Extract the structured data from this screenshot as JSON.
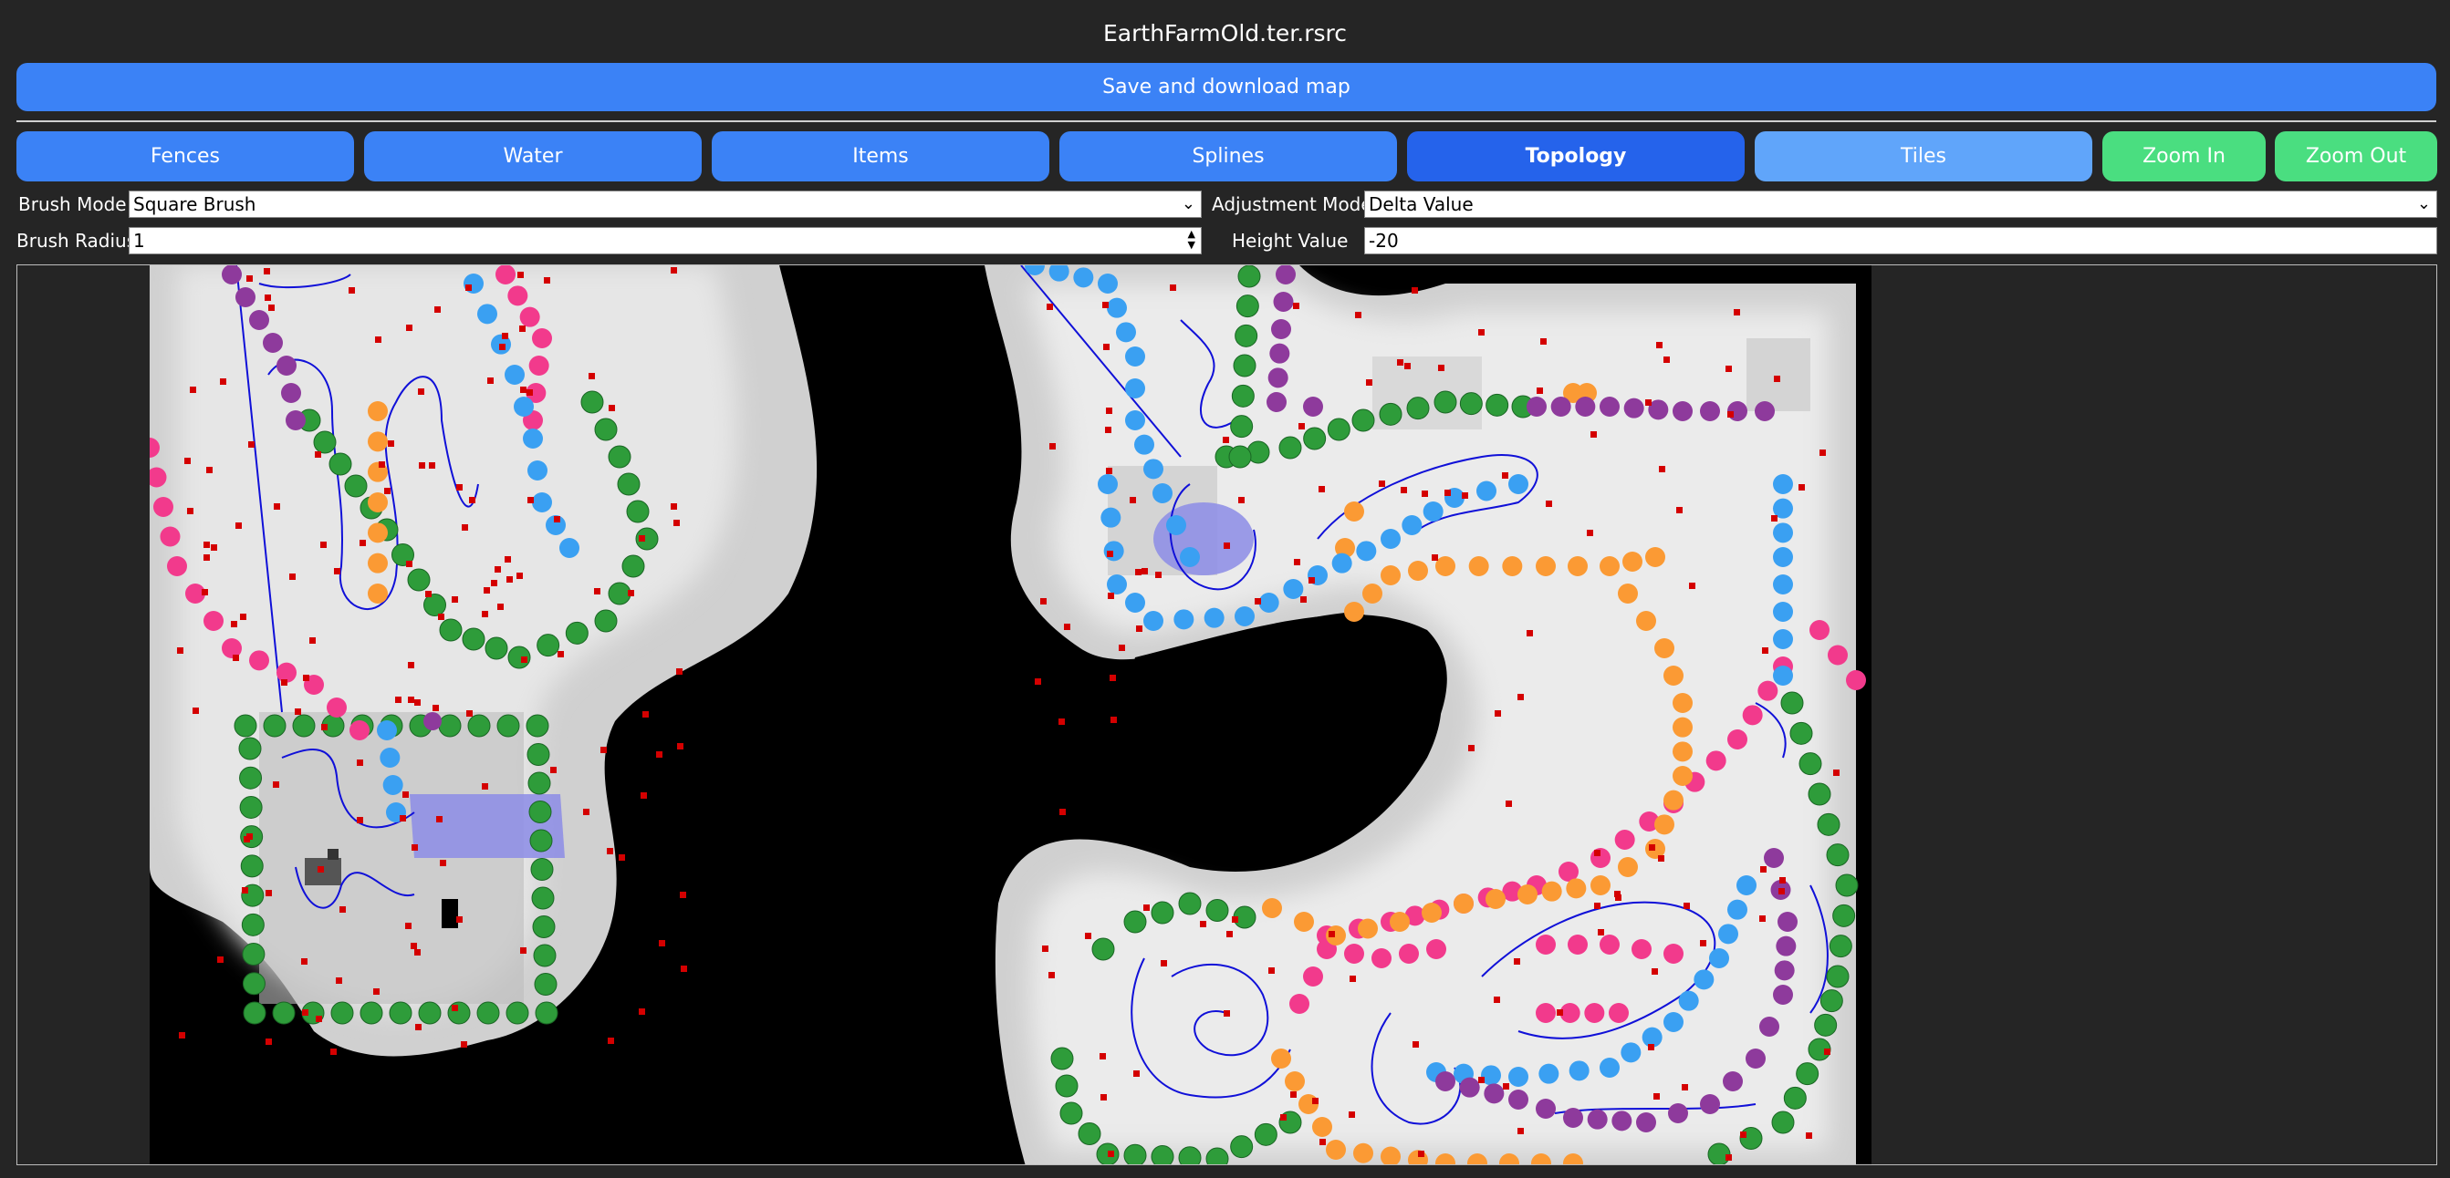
{
  "window": {
    "title": "EarthFarmOld.ter.rsrc"
  },
  "toolbar": {
    "save_label": "Save and download map"
  },
  "tabs": [
    {
      "label": "Fences",
      "state": "normal"
    },
    {
      "label": "Water",
      "state": "normal"
    },
    {
      "label": "Items",
      "state": "normal"
    },
    {
      "label": "Splines",
      "state": "normal"
    },
    {
      "label": "Topology",
      "state": "selected"
    },
    {
      "label": "Tiles",
      "state": "disabled-look"
    },
    {
      "label": "Zoom In",
      "state": "action"
    },
    {
      "label": "Zoom Out",
      "state": "action"
    }
  ],
  "controls": {
    "brush_mode": {
      "label": "Brush Mode",
      "value": "Square Brush"
    },
    "adjustment_mode": {
      "label": "Adjustment Mode",
      "value": "Delta Value"
    },
    "brush_radius": {
      "label": "Brush Radius",
      "value": "1"
    },
    "height_value": {
      "label": "Height Value",
      "value": "-20"
    }
  },
  "colors": {
    "primary": "#3b82f6",
    "selected": "#2563eb",
    "light": "#60a5fa",
    "zoom": "#4ade80",
    "fence_green": "#2e9c3a",
    "spline_blue": "#1010d8",
    "water": "#8c8ce6",
    "item_red": "#d40000",
    "pink": "#f23a8c",
    "orange": "#fb9a34",
    "sky": "#3aa0f2",
    "purple": "#8e3a9c"
  },
  "map": {
    "label_glyph": "▬"
  }
}
